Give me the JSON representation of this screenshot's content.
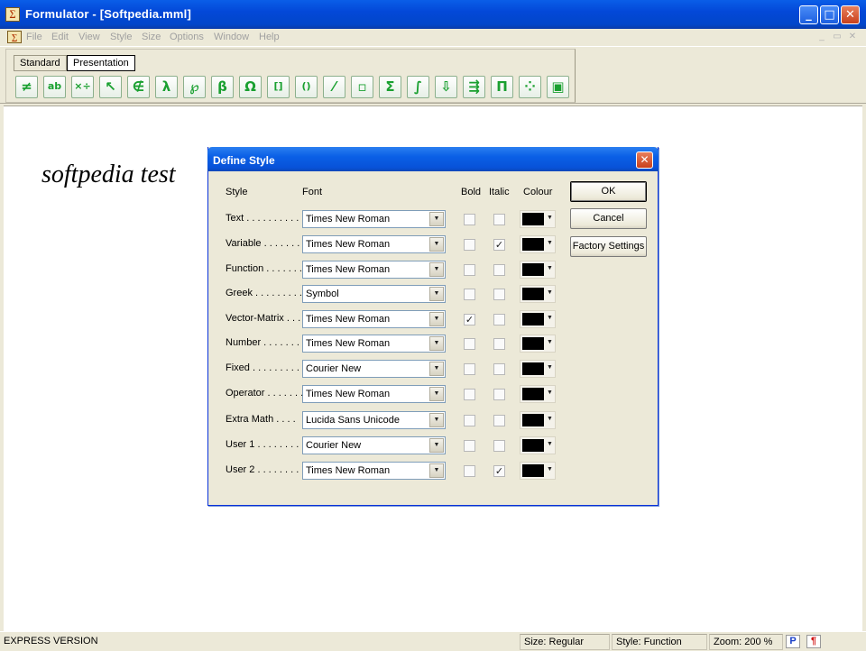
{
  "window": {
    "title": "Formulator - [Softpedia.mml]",
    "app_icon": "formulator-icon",
    "controls": {
      "minimize": "_",
      "maximize": "□",
      "close": "✕"
    }
  },
  "menu": {
    "items": [
      "File",
      "Edit",
      "View",
      "Style",
      "Size",
      "Options",
      "Window",
      "Help"
    ],
    "mdi_controls": [
      "_",
      "▭",
      "✕"
    ]
  },
  "toolbar": {
    "tabs": [
      "Standard",
      "Presentation"
    ],
    "active_tab": "Presentation",
    "buttons": [
      {
        "icon": "not-equal-icon",
        "glyph": "≠"
      },
      {
        "icon": "text-ab-icon",
        "glyph": "ab"
      },
      {
        "icon": "times-divide-icon",
        "glyph": "×÷"
      },
      {
        "icon": "arrow-icon",
        "glyph": "↖"
      },
      {
        "icon": "not-element-icon",
        "glyph": "∉"
      },
      {
        "icon": "lambda-icon",
        "glyph": "λ"
      },
      {
        "icon": "script-icon",
        "glyph": "℘"
      },
      {
        "icon": "beta-icon",
        "glyph": "β"
      },
      {
        "icon": "omega-icon",
        "glyph": "Ω"
      },
      {
        "icon": "brackets-icon",
        "glyph": "[]"
      },
      {
        "icon": "parentheses-icon",
        "glyph": "()"
      },
      {
        "icon": "fraction-icon",
        "glyph": "⁄"
      },
      {
        "icon": "superscript-icon",
        "glyph": "▫"
      },
      {
        "icon": "sum-icon",
        "glyph": "Σ"
      },
      {
        "icon": "integral-icon",
        "glyph": "∫"
      },
      {
        "icon": "underscript-icon",
        "glyph": "⇩"
      },
      {
        "icon": "over-arrow-icon",
        "glyph": "⇶"
      },
      {
        "icon": "product-icon",
        "glyph": "Π"
      },
      {
        "icon": "matrix-icon",
        "glyph": "⁘"
      },
      {
        "icon": "box-icon",
        "glyph": "▣"
      }
    ]
  },
  "document": {
    "text": "softpedia test"
  },
  "dialog": {
    "title": "Define Style",
    "headers": {
      "style": "Style",
      "font": "Font",
      "bold": "Bold",
      "italic": "Italic",
      "colour": "Colour"
    },
    "rows": [
      {
        "label": "Text . . . . . . . . . .",
        "font": "Times New Roman",
        "bold": false,
        "italic": false,
        "colour": "#000000"
      },
      {
        "label": "Variable  . . . . . . .",
        "font": "Times New Roman",
        "bold": false,
        "italic": true,
        "colour": "#000000"
      },
      {
        "label": "Function . . . . . . .",
        "font": "Times New Roman",
        "bold": false,
        "italic": false,
        "colour": "#000000"
      },
      {
        "label": "Greek . . . . . . . . .",
        "font": "Symbol",
        "bold": false,
        "italic": false,
        "colour": "#000000"
      },
      {
        "label": "Vector-Matrix . . .",
        "font": "Times New Roman",
        "bold": true,
        "italic": false,
        "colour": "#000000"
      },
      {
        "label": "Number  . . . . . . .",
        "font": "Times New Roman",
        "bold": false,
        "italic": false,
        "colour": "#000000"
      },
      {
        "label": "Fixed  . . . . . . . . .",
        "font": "Courier New",
        "bold": false,
        "italic": false,
        "colour": "#000000"
      },
      {
        "label": "Operator . . . . . . .",
        "font": "Times New Roman",
        "bold": false,
        "italic": false,
        "colour": "#000000"
      },
      {
        "label": "Extra Math  . . . .",
        "font": "Lucida Sans Unicode",
        "bold": false,
        "italic": false,
        "colour": "#000000"
      },
      {
        "label": "User 1  . . . . . . . .",
        "font": "Courier New",
        "bold": false,
        "italic": false,
        "colour": "#000000"
      },
      {
        "label": "User 2  . . . . . . . .",
        "font": "Times New Roman",
        "bold": false,
        "italic": true,
        "colour": "#000000"
      }
    ],
    "buttons": {
      "ok": "OK",
      "cancel": "Cancel",
      "factory": "Factory Settings"
    }
  },
  "status": {
    "edition": "EXPRESS VERSION",
    "size": "Size: Regular",
    "style": "Style: Function",
    "zoom": "Zoom: 200 %",
    "p_icon": "P",
    "para_icon": "¶"
  }
}
